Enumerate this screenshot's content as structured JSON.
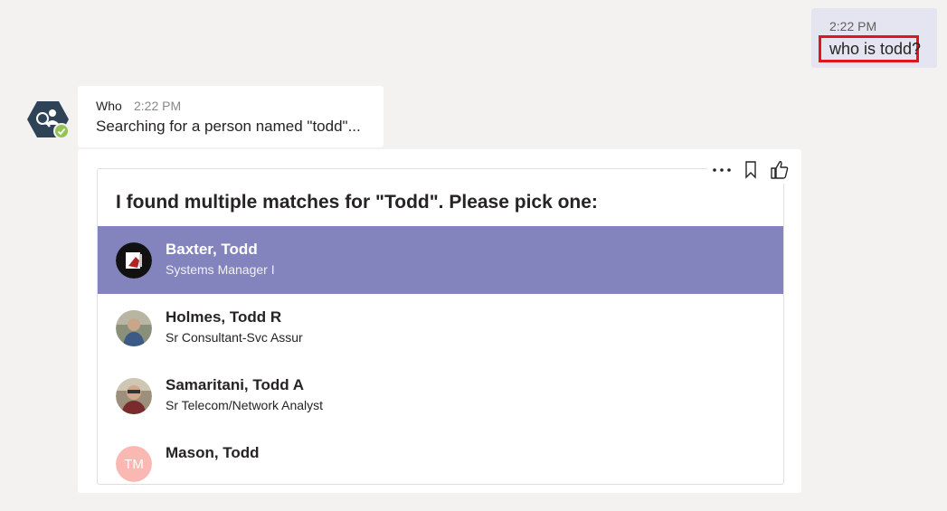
{
  "outgoing": {
    "time": "2:22 PM",
    "text": "who is todd?"
  },
  "bot": {
    "name": "Who",
    "time": "2:22 PM",
    "text": "Searching for a person named \"todd\"...",
    "avatar_icon": "person-search-icon",
    "presence_color": "#92c353"
  },
  "card": {
    "actions": [
      "more-options-icon",
      "bookmark-icon",
      "like-icon"
    ],
    "title": "I found multiple matches for \"Todd\". Please pick one:",
    "selected_color": "#8383bd",
    "people": [
      {
        "name": "Baxter, Todd",
        "title": "Systems Manager I",
        "selected": true
      },
      {
        "name": "Holmes, Todd R",
        "title": "Sr Consultant-Svc Assur",
        "selected": false
      },
      {
        "name": "Samaritani, Todd A",
        "title": "Sr Telecom/Network Analyst",
        "selected": false
      },
      {
        "name": "Mason, Todd",
        "title": "",
        "initials": "TM",
        "selected": false
      }
    ]
  }
}
